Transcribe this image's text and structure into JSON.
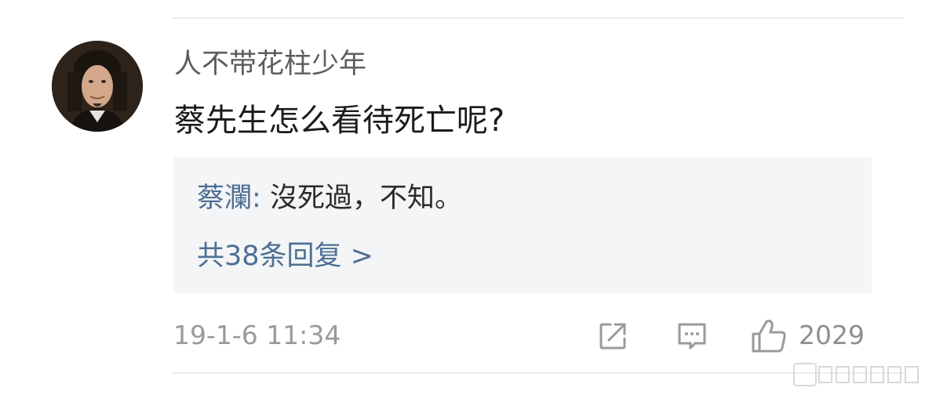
{
  "comment": {
    "username": "人不带花柱少年",
    "text": "蔡先生怎么看待死亡呢?",
    "timestamp": "19-1-6 11:34",
    "like_count": "2029"
  },
  "reply": {
    "author": "蔡瀾",
    "separator": ": ",
    "content": "沒死過，不知。",
    "count_label": "共38条回复 >"
  },
  "icons": {
    "share": "share-icon",
    "comment": "comment-icon",
    "like": "thumbs-up-icon"
  },
  "colors": {
    "link": "#4d6f94",
    "text": "#1b1b1b",
    "muted": "#9a9a9a",
    "reply_bg": "#f4f5f6"
  }
}
